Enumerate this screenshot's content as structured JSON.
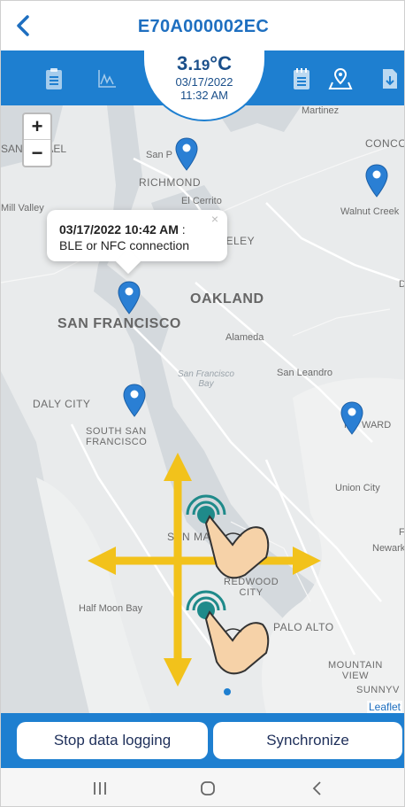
{
  "header": {
    "device_id": "E70A000002EC"
  },
  "temperature": {
    "value_main": "3.",
    "value_decimal": "19",
    "unit": "°C",
    "date": "03/17/2022",
    "time": "11:32 AM"
  },
  "toolbar": {
    "icons": [
      "clipboard-icon",
      "chart-icon",
      "notepad-icon",
      "map-pin-icon",
      "file-download-icon"
    ]
  },
  "map": {
    "zoom_in": "+",
    "zoom_out": "−",
    "labels": {
      "san_rafael": "SAN RAFAEL",
      "san_pablo": "San P",
      "richmond": "RICHMOND",
      "el_cerrito": "El Cerrito",
      "mill_valley": "Mill Valley",
      "berkeley": "KELEY",
      "martinez": "Martinez",
      "concord": "CONCO",
      "walnut_creek": "Walnut Creek",
      "oakland": "OAKLAND",
      "alameda": "Alameda",
      "san_francisco": "SAN FRANCISCO",
      "sf_bay": "San Francisco\nBay",
      "san_leandro": "San Leandro",
      "daly_city": "DALY CITY",
      "south_sf": "SOUTH SAN\nFRANCISCO",
      "hayward": "WARD",
      "hayward_h": "H",
      "union_city": "Union City",
      "san_mateo": "SAN MA",
      "newark": "Newark",
      "redwood_city": "REDWOOD\nCITY",
      "half_moon_bay": "Half Moon Bay",
      "palo_alto": "PALO ALTO",
      "mountain_view": "MOUNTAIN\nVIEW",
      "sunnyvale": "SUNNYV",
      "d_edge": "D",
      "f_edge": "F"
    },
    "popup": {
      "timestamp": "03/17/2022 10:42 AM",
      "separator": " :",
      "text": "BLE or NFC connection",
      "close": "×"
    },
    "attribution": "Leaflet"
  },
  "actions": {
    "stop_label": "Stop data logging",
    "sync_label": "Synchronize"
  },
  "nav": {
    "icons": [
      "recent-apps-icon",
      "home-icon",
      "back-nav-icon"
    ]
  },
  "colors": {
    "primary": "#1e7fd0",
    "title": "#1e6fc0",
    "pin": "#2a7fd4",
    "arrow": "#f2c21b",
    "touch": "#1f8a8a"
  }
}
